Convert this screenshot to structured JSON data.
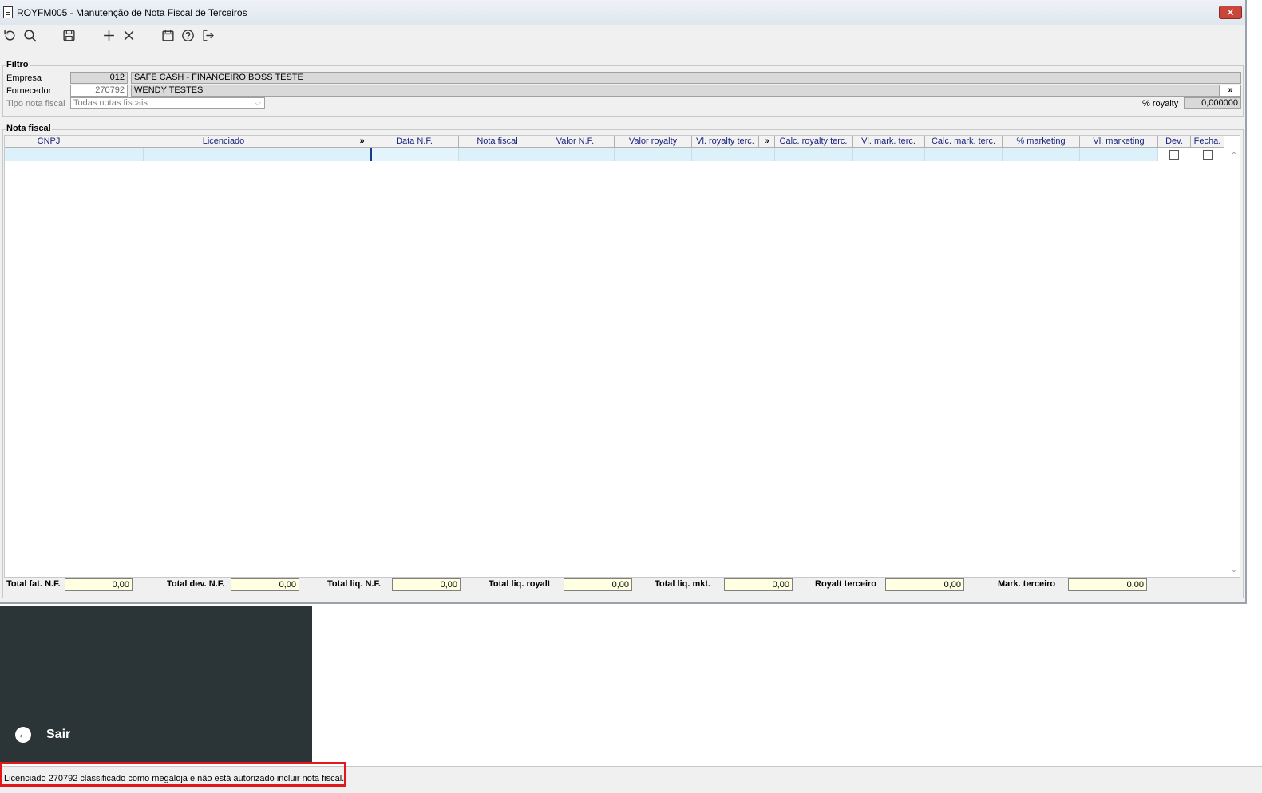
{
  "window": {
    "title": "ROYFM005 - Manutenção de Nota Fiscal de Terceiros",
    "close_label": "✕"
  },
  "toolbar": {
    "items": [
      {
        "name": "refresh-icon"
      },
      {
        "name": "search-icon"
      },
      {
        "name": "save-icon"
      },
      {
        "name": "add-icon"
      },
      {
        "name": "delete-icon"
      },
      {
        "name": "calendar-icon"
      },
      {
        "name": "help-icon"
      },
      {
        "name": "exit-icon"
      }
    ]
  },
  "filtro": {
    "title": "Filtro",
    "empresa_label": "Empresa",
    "empresa_code": "012",
    "empresa_name": "SAFE CASH - FINANCEIRO BOSS TESTE",
    "fornecedor_label": "Fornecedor",
    "fornecedor_code": "270792",
    "fornecedor_name": "WENDY TESTES",
    "tipo_label": "Tipo nota fiscal",
    "tipo_value": "Todas notas fiscais",
    "royalty_label": "% royalty",
    "royalty_value": "0,000000",
    "expand_label": "»"
  },
  "grid": {
    "title": "Nota fiscal",
    "columns": [
      "CNPJ",
      "Licenciado",
      "»",
      "Data N.F.",
      "Nota fiscal",
      "Valor N.F.",
      "Valor royalty",
      "Vl. royalty terc.",
      "»",
      "Calc. royalty terc.",
      "Vl. mark. terc.",
      "Calc. mark. terc.",
      "% marketing",
      "Vl. marketing",
      "Dev.",
      "Fecha."
    ]
  },
  "totals": {
    "fat_label": "Total fat. N.F.",
    "fat_value": "0,00",
    "dev_label": "Total dev. N.F.",
    "dev_value": "0,00",
    "liq_label": "Total liq. N.F.",
    "liq_value": "0,00",
    "roy_label": "Total liq. royalt",
    "roy_value": "0,00",
    "mkt_label": "Total liq. mkt.",
    "mkt_value": "0,00",
    "royterc_label": "Royalt terceiro",
    "royterc_value": "0,00",
    "markterc_label": "Mark. terceiro",
    "markterc_value": "0,00"
  },
  "sidebar": {
    "sair_label": "Sair"
  },
  "status": {
    "message": "Licenciado 270792 classificado como megaloja e não está autorizado incluir nota fiscal.",
    "highlight_color": "#e2161b"
  }
}
